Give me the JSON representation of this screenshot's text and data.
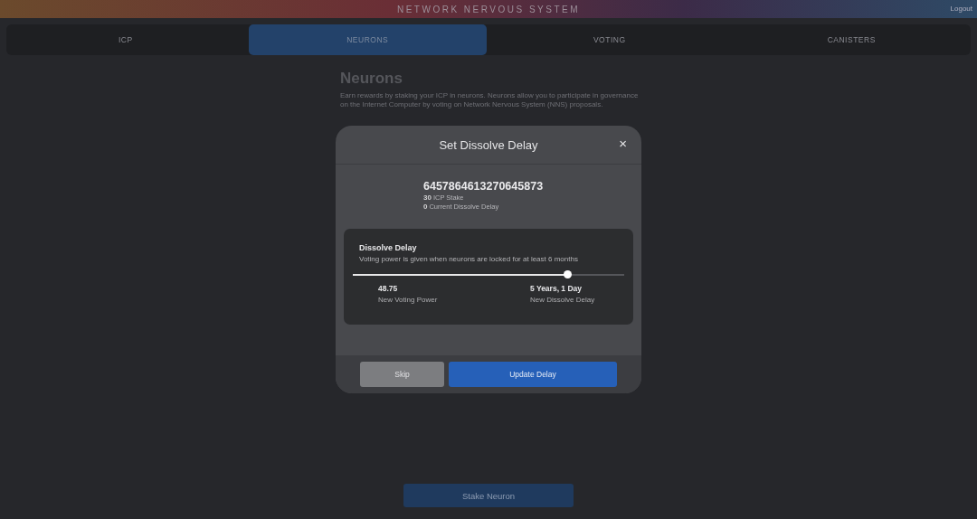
{
  "header": {
    "title": "NETWORK NERVOUS SYSTEM",
    "logout": "Logout"
  },
  "tabs": [
    {
      "label": "ICP",
      "selected": false
    },
    {
      "label": "NEURONS",
      "selected": true
    },
    {
      "label": "VOTING",
      "selected": false
    },
    {
      "label": "CANISTERS",
      "selected": false
    }
  ],
  "page": {
    "heading": "Neurons",
    "description": "Earn rewards by staking your ICP in neurons. Neurons allow you to participate in governance on the Internet Computer by voting on Network Nervous System (NNS) proposals.",
    "stake_button": "Stake Neuron"
  },
  "dialog": {
    "title": "Set Dissolve Delay",
    "close": "×",
    "neuron_id": "6457864613270645873",
    "stake": {
      "value": "30",
      "label": "ICP Stake"
    },
    "current_delay": {
      "value": "0",
      "label": "Current Dissolve Delay"
    },
    "delay_card": {
      "title": "Dissolve Delay",
      "hint": "Voting power is given when neurons are locked for at least 6 months",
      "slider": {
        "level": 0.79
      },
      "voting_power": {
        "value": "48.75",
        "label": "New Voting Power"
      },
      "dissolve_delay": {
        "value": "5 Years, 1 Day",
        "label": "New Dissolve Delay"
      }
    },
    "buttons": [
      {
        "label": "Skip",
        "kind": "secondary"
      },
      {
        "label": "Update Delay",
        "kind": "primary"
      }
    ]
  }
}
